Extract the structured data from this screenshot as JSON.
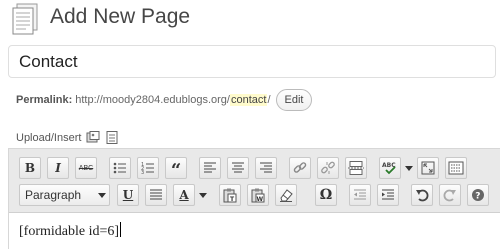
{
  "header": {
    "title": "Add New Page",
    "icon": "page-icon"
  },
  "title_field": {
    "value": "Contact"
  },
  "permalink": {
    "label": "Permalink:",
    "url_prefix": "http://moody2804.edublogs.org/",
    "slug": "contact",
    "url_suffix": "/",
    "edit_label": "Edit"
  },
  "upload": {
    "label": "Upload/Insert",
    "icons": [
      "add-image-icon",
      "add-media-icon"
    ]
  },
  "toolbar": {
    "format_select": "Paragraph",
    "row1": [
      "bold",
      "italic",
      "strikethrough",
      "bullet-list",
      "numbered-list",
      "blockquote",
      "align-left",
      "align-center",
      "align-right",
      "insert-link",
      "unlink",
      "insert-more",
      "spellcheck",
      "fullscreen",
      "kitchen-sink"
    ],
    "row2": [
      "underline",
      "justify",
      "text-color",
      "paste-text",
      "paste-word",
      "clear-formatting",
      "special-character",
      "outdent",
      "indent",
      "undo",
      "redo",
      "help"
    ],
    "labels": {
      "bold": "B",
      "italic": "I",
      "strike": "ABC",
      "blockquote": "“",
      "underline": "U",
      "textcolor": "A",
      "omega": "Ω"
    }
  },
  "editor": {
    "content": "[formidable id=6]"
  },
  "colors": {
    "slug_highlight": "#fffbcc",
    "toolbar_bg": "#e9e9e9"
  }
}
